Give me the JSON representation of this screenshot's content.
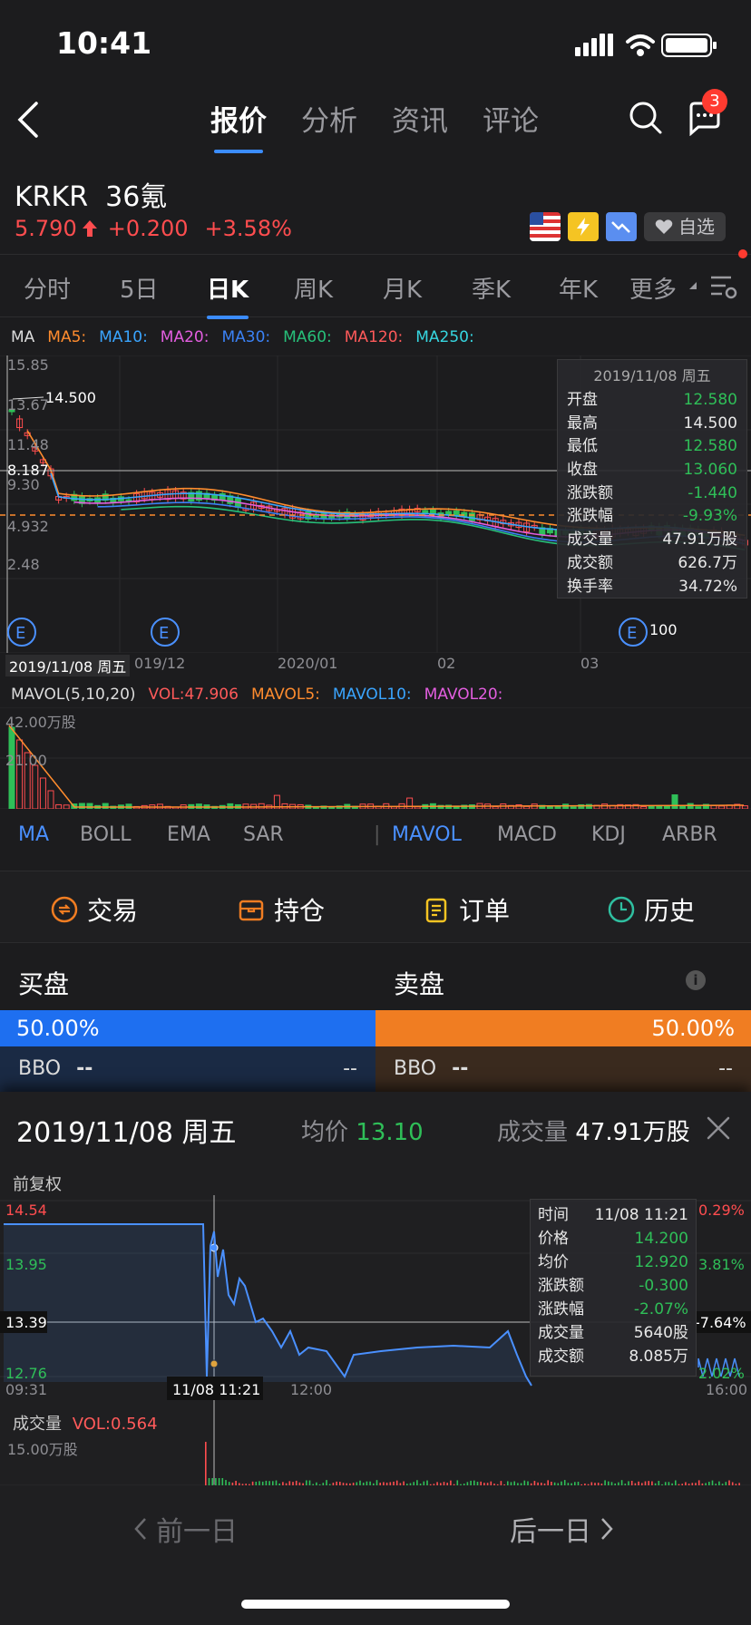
{
  "status": {
    "time": "10:41"
  },
  "nav": {
    "tabs": [
      "报价",
      "分析",
      "资讯",
      "评论"
    ],
    "active_tab": "报价",
    "badge_count": "3"
  },
  "stock": {
    "symbol": "KRKR",
    "name": "36氪",
    "price": "5.790",
    "change": "+0.200",
    "change_pct": "+3.58%",
    "watch_label": "自选"
  },
  "periods": [
    "分时",
    "5日",
    "日K",
    "周K",
    "月K",
    "季K",
    "年K",
    "更多"
  ],
  "ma_legend": {
    "ma": "MA",
    "items": [
      {
        "label": "MA5:",
        "color": "#ff8c2e"
      },
      {
        "label": "MA10:",
        "color": "#3aa5ff"
      },
      {
        "label": "MA20:",
        "color": "#e35ee0"
      },
      {
        "label": "MA30:",
        "color": "#3b82f6"
      },
      {
        "label": "MA60:",
        "color": "#27c07a"
      },
      {
        "label": "MA120:",
        "color": "#ff5a5a"
      },
      {
        "label": "MA250:",
        "color": "#36d6e0"
      }
    ]
  },
  "kchart": {
    "y_labels": [
      "15.85",
      "13.67",
      "11.48",
      "9.30",
      "8.187",
      "4.932",
      "2.48"
    ],
    "high_label": "14.500",
    "low_label": "100",
    "event_marker": "E"
  },
  "info_panel": {
    "header": "2019/11/08 周五",
    "rows": [
      {
        "k": "开盘",
        "v": "12.580",
        "c": "green"
      },
      {
        "k": "最高",
        "v": "14.500",
        "c": "white"
      },
      {
        "k": "最低",
        "v": "12.580",
        "c": "green"
      },
      {
        "k": "收盘",
        "v": "13.060",
        "c": "green"
      },
      {
        "k": "涨跌额",
        "v": "-1.440",
        "c": "green"
      },
      {
        "k": "涨跌幅",
        "v": "-9.93%",
        "c": "green"
      },
      {
        "k": "成交量",
        "v": "47.91万股",
        "c": "white"
      },
      {
        "k": "成交额",
        "v": "626.7万",
        "c": "white"
      },
      {
        "k": "换手率",
        "v": "34.72%",
        "c": "white"
      }
    ]
  },
  "date_axis": {
    "cursor": "2019/11/08 周五",
    "ticks": [
      "019/12",
      "2020/01",
      "02",
      "03"
    ]
  },
  "mavol": {
    "title": "MAVOL(5,10,20)",
    "vol": "VOL:47.906",
    "m5": "MAVOL5:",
    "m10": "MAVOL10:",
    "m20": "MAVOL20:",
    "y_top": "42.00万股",
    "y_mid": "21.00"
  },
  "indicators": {
    "left": [
      "MA",
      "BOLL",
      "EMA",
      "SAR"
    ],
    "right": [
      "MAVOL",
      "MACD",
      "KDJ",
      "ARBR"
    ]
  },
  "trade": [
    "交易",
    "持仓",
    "订单",
    "历史"
  ],
  "book": {
    "bid": "买盘",
    "ask": "卖盘",
    "bid_pct": "50.00%",
    "ask_pct": "50.00%",
    "bbo": "BBO",
    "dash": "--",
    "dash_right": "--"
  },
  "sheet": {
    "date": "2019/11/08 周五",
    "avg_label": "均价",
    "avg": "13.10",
    "vol_label": "成交量",
    "vol": "47.91万股",
    "adj": "前复权",
    "y_left": [
      "14.54",
      "13.95",
      "13.39",
      "12.76"
    ],
    "y_right": [
      "0.29%",
      "3.81%",
      "-7.64%",
      "2.02%"
    ],
    "x": [
      "09:31",
      "11/08 11:21",
      "12:00",
      "16:00"
    ],
    "panel": [
      {
        "k": "时间",
        "v": "11/08 11:21",
        "c": "white"
      },
      {
        "k": "价格",
        "v": "14.200",
        "c": "green"
      },
      {
        "k": "均价",
        "v": "12.920",
        "c": "green"
      },
      {
        "k": "涨跌额",
        "v": "-0.300",
        "c": "green"
      },
      {
        "k": "涨跌幅",
        "v": "-2.07%",
        "c": "green"
      },
      {
        "k": "成交量",
        "v": "5640股",
        "c": "white"
      },
      {
        "k": "成交额",
        "v": "8.085万",
        "c": "white"
      }
    ],
    "vol_title": "成交量",
    "vol_val": "VOL:0.564",
    "vol_max": "15.00万股",
    "prev": "前一日",
    "next": "后一日"
  }
}
